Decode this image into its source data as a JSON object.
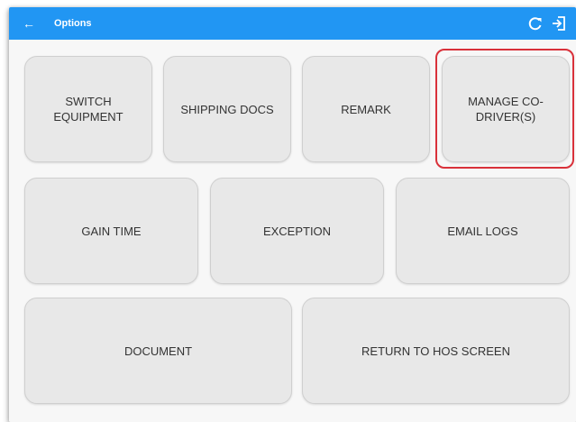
{
  "appbar": {
    "title": "Options",
    "back_icon": "arrow-left-icon",
    "refresh_icon": "refresh-icon",
    "logout_icon": "logout-icon",
    "color": "#2196f3"
  },
  "options": {
    "switch_equipment": "SWITCH EQUIPMENT",
    "shipping_docs": "SHIPPING DOCS",
    "remark": "REMARK",
    "manage_co_drivers": "MANAGE CO-DRIVER(S)",
    "gain_time": "GAIN TIME",
    "exception": "EXCEPTION",
    "email_logs": "EMAIL LOGS",
    "document": "DOCUMENT",
    "return_to_hos": "RETURN TO HOS SCREEN"
  },
  "highlight_color": "#d9313a"
}
